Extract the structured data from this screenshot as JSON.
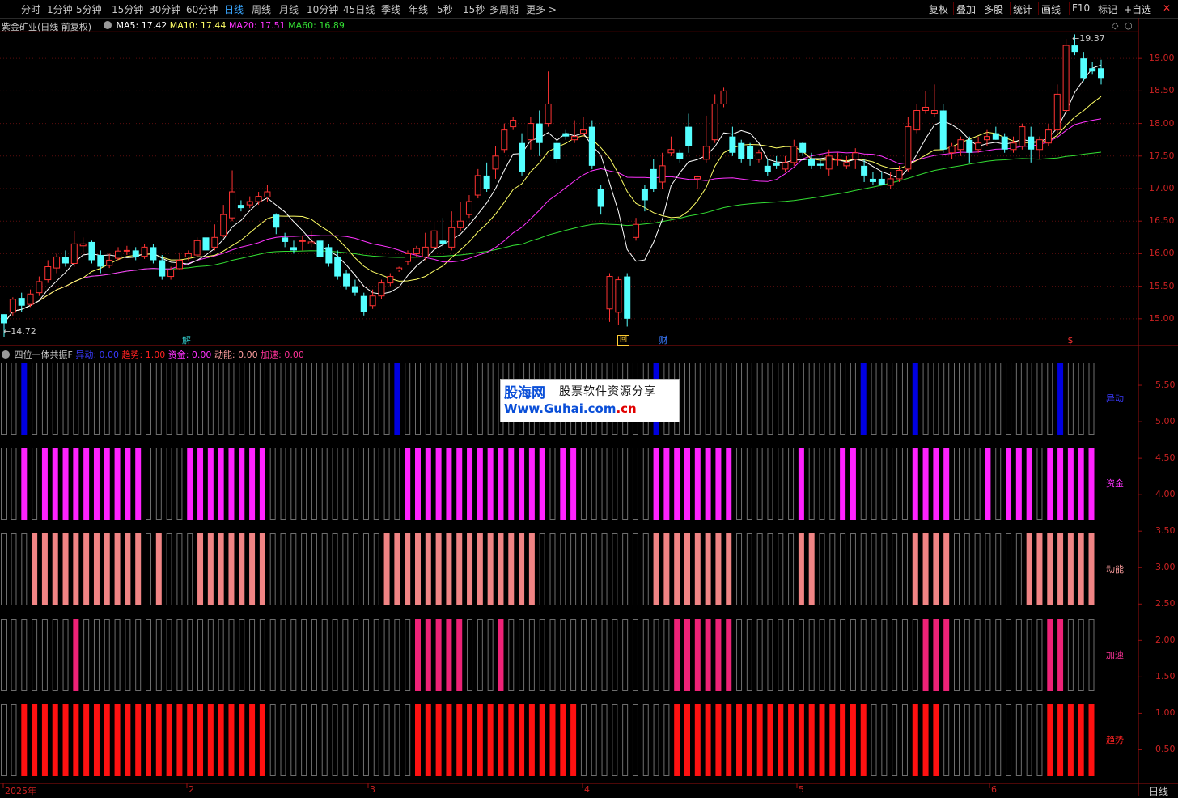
{
  "toolbar": {
    "periods": [
      "分时",
      "1分钟",
      "5分钟",
      "15分钟",
      "30分钟",
      "60分钟",
      "日线",
      "周线",
      "月线",
      "10分钟",
      "45日线",
      "季线",
      "年线",
      "5秒",
      "15秒",
      "多周期",
      "更多 >"
    ],
    "active_period": "日线",
    "tools": [
      "复权",
      "叠加",
      "多股",
      "统计",
      "画线",
      "F10",
      "标记",
      "+自选"
    ],
    "close_symbol": "✕"
  },
  "price_panel": {
    "title": "紫金矿业(日线 前复权)",
    "ma_labels": [
      {
        "text": "MA5: 17.42",
        "color": "#ffffff"
      },
      {
        "text": "MA10: 17.44",
        "color": "#ffff66"
      },
      {
        "text": "MA20: 17.51",
        "color": "#ff33ff"
      },
      {
        "text": "MA60: 16.89",
        "color": "#33dd33"
      }
    ],
    "y_ticks": [
      "19.00",
      "18.50",
      "18.00",
      "17.50",
      "17.00",
      "16.50",
      "16.00",
      "15.50",
      "15.00"
    ],
    "high_label": "19.37",
    "low_label": "14.72",
    "markers": [
      {
        "text": "解",
        "color": "#33cccc"
      },
      {
        "text": "回",
        "color": "#ffcc33"
      },
      {
        "text": "财",
        "color": "#3a7aff"
      },
      {
        "text": "$",
        "color": "#ff3333"
      }
    ],
    "up_color": "#ff3333",
    "down_color": "#54ffff"
  },
  "indicator_panel": {
    "title": "四位一体共振F",
    "values": [
      {
        "text": "异动: 0.00",
        "color": "#3a3aff"
      },
      {
        "text": "趋势: 1.00",
        "color": "#ff2222"
      },
      {
        "text": "资金: 0.00",
        "color": "#ff33ff"
      },
      {
        "text": "动能: 0.00",
        "color": "#ff9f9f"
      },
      {
        "text": "加速: 0.00",
        "color": "#ff3399"
      }
    ],
    "y_ticks": [
      "5.50",
      "5.00",
      "4.50",
      "4.00",
      "3.50",
      "3.00",
      "2.50",
      "2.00",
      "1.50",
      "1.00",
      "0.50"
    ],
    "row_labels": [
      {
        "text": "异动",
        "color": "#3a3aff"
      },
      {
        "text": "资金",
        "color": "#ff33ff"
      },
      {
        "text": "动能",
        "color": "#ff9f9f"
      },
      {
        "text": "加速",
        "color": "#ff3399"
      },
      {
        "text": "趋势",
        "color": "#ff2222"
      }
    ],
    "row_colors": [
      "#0000e0",
      "#ff22ff",
      "#f08484",
      "#ee2277",
      "#ff1111"
    ],
    "row_on_ranges": [
      [
        [
          1,
          1
        ],
        [
          37,
          37
        ],
        [
          62,
          62
        ],
        [
          82,
          82
        ],
        [
          87,
          87
        ],
        [
          101,
          101
        ]
      ],
      [
        [
          1,
          1
        ],
        [
          3,
          12
        ],
        [
          17,
          24
        ],
        [
          38,
          51
        ],
        [
          53,
          54
        ],
        [
          62,
          69
        ],
        [
          76,
          76
        ],
        [
          80,
          81
        ],
        [
          87,
          90
        ],
        [
          94,
          94
        ],
        [
          96,
          98
        ],
        [
          100,
          104
        ]
      ],
      [
        [
          2,
          12
        ],
        [
          14,
          14
        ],
        [
          18,
          24
        ],
        [
          36,
          50
        ],
        [
          62,
          69
        ],
        [
          76,
          77
        ],
        [
          87,
          90
        ],
        [
          98,
          104
        ]
      ],
      [
        [
          6,
          6
        ],
        [
          39,
          43
        ],
        [
          47,
          47
        ],
        [
          64,
          69
        ],
        [
          88,
          90
        ],
        [
          100,
          101
        ]
      ],
      [
        [
          1,
          24
        ],
        [
          39,
          54
        ],
        [
          64,
          82
        ],
        [
          87,
          89
        ],
        [
          100,
          104
        ]
      ]
    ]
  },
  "bottom_axis": {
    "labels": [
      "2025年",
      "2",
      "3",
      "4",
      "5",
      "6"
    ],
    "period": "日线"
  },
  "watermark": {
    "brand": "股海网",
    "slogan": "股票软件资源分享",
    "url_prefix": "Www.Guhai.com",
    "url_suffix": ".cn"
  },
  "chart_data": {
    "type": "candlestick",
    "title": "紫金矿业(日线 前复权)",
    "ylim": [
      14.6,
      19.4
    ],
    "bars": [
      [
        15.07,
        14.93,
        15.07,
        14.72
      ],
      [
        15.1,
        15.3,
        15.33,
        15.05
      ],
      [
        15.32,
        15.2,
        15.4,
        15.1
      ],
      [
        15.22,
        15.38,
        15.45,
        15.18
      ],
      [
        15.4,
        15.57,
        15.65,
        15.35
      ],
      [
        15.6,
        15.8,
        15.9,
        15.55
      ],
      [
        15.78,
        15.95,
        16.0,
        15.7
      ],
      [
        15.95,
        15.85,
        16.05,
        15.8
      ],
      [
        15.85,
        16.15,
        16.35,
        15.8
      ],
      [
        16.12,
        16.15,
        16.25,
        16.0
      ],
      [
        16.18,
        15.9,
        16.2,
        15.85
      ],
      [
        15.98,
        15.8,
        16.05,
        15.7
      ],
      [
        15.82,
        15.9,
        16.0,
        15.78
      ],
      [
        15.93,
        16.04,
        16.1,
        15.9
      ],
      [
        16.05,
        16.05,
        16.12,
        15.98
      ],
      [
        16.05,
        15.95,
        16.1,
        15.9
      ],
      [
        15.96,
        16.1,
        16.15,
        15.92
      ],
      [
        16.1,
        15.9,
        16.15,
        15.85
      ],
      [
        15.9,
        15.65,
        15.98,
        15.6
      ],
      [
        15.65,
        15.75,
        15.8,
        15.6
      ],
      [
        15.77,
        15.9,
        16.02,
        15.75
      ],
      [
        15.95,
        16.0,
        16.05,
        15.9
      ],
      [
        15.98,
        16.2,
        16.25,
        15.94
      ],
      [
        16.25,
        16.05,
        16.35,
        16.0
      ],
      [
        16.1,
        16.25,
        16.45,
        16.05
      ],
      [
        16.28,
        16.6,
        16.75,
        16.25
      ],
      [
        16.55,
        16.95,
        17.28,
        16.5
      ],
      [
        16.75,
        16.7,
        16.82,
        16.65
      ],
      [
        16.75,
        16.8,
        16.88,
        16.7
      ],
      [
        16.8,
        16.88,
        16.95,
        16.75
      ],
      [
        16.87,
        16.95,
        17.05,
        16.8
      ],
      [
        16.6,
        16.4,
        16.62,
        16.3
      ],
      [
        16.25,
        16.18,
        16.32,
        16.1
      ],
      [
        16.1,
        16.05,
        16.2,
        16.0
      ],
      [
        16.2,
        16.2,
        16.28,
        16.05
      ],
      [
        16.15,
        16.18,
        16.35,
        16.1
      ],
      [
        16.2,
        15.95,
        16.25,
        15.9
      ],
      [
        16.1,
        15.85,
        16.15,
        15.8
      ],
      [
        15.95,
        15.65,
        16.05,
        15.6
      ],
      [
        15.7,
        15.5,
        15.75,
        15.45
      ],
      [
        15.5,
        15.4,
        15.6,
        15.35
      ],
      [
        15.35,
        15.1,
        15.4,
        15.05
      ],
      [
        15.2,
        15.35,
        15.45,
        15.15
      ],
      [
        15.35,
        15.55,
        15.6,
        15.3
      ],
      [
        15.55,
        15.65,
        15.7,
        15.5
      ],
      [
        15.75,
        15.78,
        15.8,
        15.72
      ],
      [
        15.88,
        16.0,
        16.05,
        15.82
      ],
      [
        16.0,
        16.08,
        16.12,
        15.95
      ],
      [
        15.95,
        16.1,
        16.32,
        15.9
      ],
      [
        16.1,
        16.35,
        16.5,
        16.05
      ],
      [
        16.2,
        16.15,
        16.55,
        16.1
      ],
      [
        16.1,
        16.4,
        16.65,
        16.05
      ],
      [
        16.4,
        16.5,
        16.8,
        16.35
      ],
      [
        16.6,
        16.8,
        16.9,
        16.55
      ],
      [
        16.9,
        17.2,
        17.3,
        16.85
      ],
      [
        17.2,
        17.0,
        17.4,
        16.95
      ],
      [
        17.3,
        17.5,
        17.65,
        17.15
      ],
      [
        17.6,
        17.9,
        18.0,
        17.55
      ],
      [
        17.95,
        18.05,
        18.1,
        17.9
      ],
      [
        17.7,
        17.25,
        17.85,
        17.2
      ],
      [
        17.75,
        18.0,
        18.1,
        17.6
      ],
      [
        18.0,
        17.7,
        18.2,
        17.5
      ],
      [
        18.0,
        18.3,
        18.8,
        17.95
      ],
      [
        17.7,
        17.45,
        17.75,
        17.4
      ],
      [
        17.85,
        17.8,
        17.9,
        17.75
      ],
      [
        17.75,
        17.8,
        18.05,
        17.7
      ],
      [
        17.85,
        17.9,
        18.1,
        17.8
      ],
      [
        17.95,
        17.35,
        18.05,
        17.3
      ],
      [
        17.0,
        16.72,
        17.05,
        16.6
      ],
      [
        15.15,
        15.65,
        15.7,
        14.95
      ],
      [
        15.1,
        15.6,
        15.65,
        14.9
      ],
      [
        15.65,
        15.0,
        15.7,
        14.88
      ],
      [
        16.25,
        16.45,
        16.55,
        16.2
      ],
      [
        17.0,
        16.82,
        17.05,
        16.65
      ],
      [
        17.3,
        17.0,
        17.45,
        16.95
      ],
      [
        17.1,
        17.35,
        17.55,
        17.0
      ],
      [
        17.55,
        17.6,
        17.8,
        17.5
      ],
      [
        17.55,
        17.45,
        17.6,
        17.4
      ],
      [
        17.95,
        17.65,
        18.15,
        17.55
      ],
      [
        17.15,
        17.18,
        17.2,
        17.0
      ],
      [
        17.45,
        17.65,
        18.12,
        17.4
      ],
      [
        17.75,
        18.3,
        18.45,
        17.7
      ],
      [
        18.3,
        18.5,
        18.55,
        18.25
      ],
      [
        17.8,
        17.55,
        17.95,
        17.5
      ],
      [
        17.7,
        17.45,
        17.75,
        17.4
      ],
      [
        17.65,
        17.45,
        17.7,
        17.35
      ],
      [
        17.45,
        17.55,
        17.6,
        17.4
      ],
      [
        17.35,
        17.25,
        17.45,
        17.2
      ],
      [
        17.4,
        17.35,
        17.5,
        17.3
      ],
      [
        17.3,
        17.4,
        17.5,
        17.25
      ],
      [
        17.4,
        17.65,
        17.75,
        17.35
      ],
      [
        17.7,
        17.55,
        17.72,
        17.5
      ],
      [
        17.45,
        17.35,
        17.55,
        17.3
      ],
      [
        17.38,
        17.35,
        17.45,
        17.3
      ],
      [
        17.3,
        17.5,
        17.6,
        17.2
      ],
      [
        17.45,
        17.45,
        17.55,
        17.35
      ],
      [
        17.35,
        17.4,
        17.5,
        17.3
      ],
      [
        17.45,
        17.55,
        17.62,
        17.3
      ],
      [
        17.35,
        17.2,
        17.45,
        17.1
      ],
      [
        17.15,
        17.1,
        17.25,
        17.05
      ],
      [
        17.15,
        17.05,
        17.25,
        17.05
      ],
      [
        17.05,
        17.15,
        17.25,
        17.0
      ],
      [
        17.15,
        17.28,
        17.35,
        17.1
      ],
      [
        17.3,
        17.95,
        18.1,
        17.25
      ],
      [
        17.9,
        18.2,
        18.3,
        17.85
      ],
      [
        18.2,
        18.25,
        18.5,
        18.15
      ],
      [
        18.15,
        18.2,
        18.6,
        18.1
      ],
      [
        18.2,
        17.6,
        18.3,
        17.55
      ],
      [
        17.55,
        17.65,
        17.7,
        17.45
      ],
      [
        17.6,
        17.75,
        17.8,
        17.5
      ],
      [
        17.75,
        17.55,
        17.8,
        17.4
      ],
      [
        17.6,
        17.7,
        17.8,
        17.55
      ],
      [
        17.75,
        17.8,
        17.9,
        17.65
      ],
      [
        17.85,
        17.75,
        17.95,
        17.75
      ],
      [
        17.8,
        17.6,
        17.85,
        17.55
      ],
      [
        17.6,
        17.7,
        17.8,
        17.55
      ],
      [
        17.65,
        17.95,
        18.0,
        17.6
      ],
      [
        17.8,
        17.6,
        17.95,
        17.4
      ],
      [
        17.6,
        17.75,
        17.8,
        17.45
      ],
      [
        17.7,
        17.9,
        18.0,
        17.65
      ],
      [
        17.9,
        18.45,
        18.6,
        17.85
      ],
      [
        18.2,
        19.2,
        19.3,
        18.15
      ],
      [
        19.2,
        19.1,
        19.37,
        19.05
      ],
      [
        19.0,
        18.7,
        19.1,
        18.65
      ],
      [
        18.85,
        18.8,
        18.95,
        18.75
      ],
      [
        18.85,
        18.7,
        18.98,
        18.6
      ]
    ]
  }
}
